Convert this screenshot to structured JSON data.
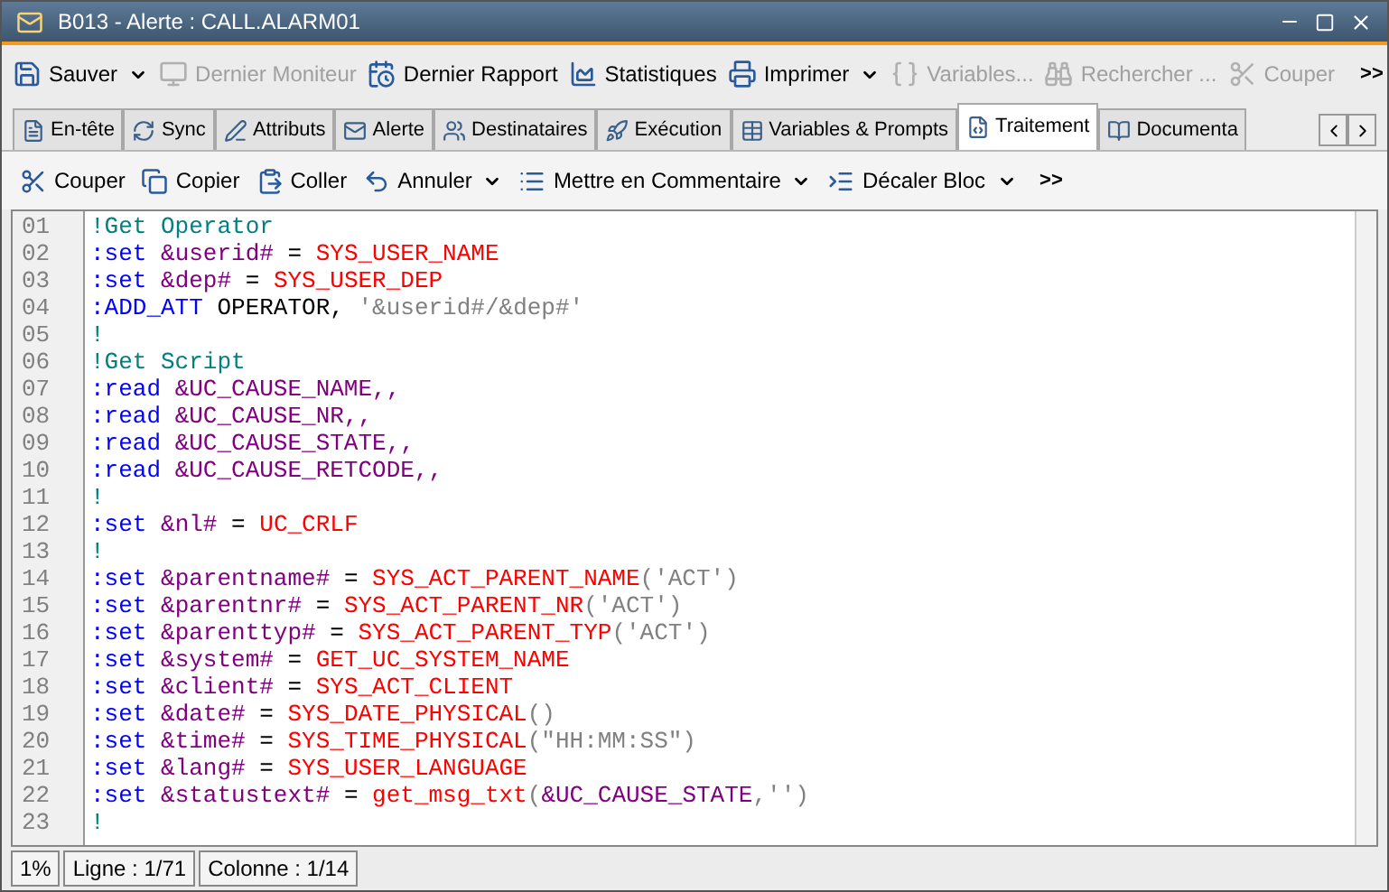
{
  "window": {
    "title": "B013 - Alerte : CALL.ALARM01"
  },
  "toolbar": [
    {
      "label": "Sauver",
      "disabled": false,
      "dropdown": true
    },
    {
      "label": "Dernier Moniteur",
      "disabled": true,
      "dropdown": false
    },
    {
      "label": "Dernier Rapport",
      "disabled": false,
      "dropdown": false
    },
    {
      "label": "Statistiques",
      "disabled": false,
      "dropdown": false
    },
    {
      "label": "Imprimer",
      "disabled": false,
      "dropdown": true
    },
    {
      "label": "Variables...",
      "disabled": true,
      "dropdown": false
    },
    {
      "label": "Rechercher ...",
      "disabled": true,
      "dropdown": false
    },
    {
      "label": "Couper",
      "disabled": true,
      "dropdown": false
    }
  ],
  "toolbar_overflow": ">>",
  "tabs": [
    {
      "label": "En-tête",
      "selected": false
    },
    {
      "label": "Sync",
      "selected": false
    },
    {
      "label": "Attributs",
      "selected": false
    },
    {
      "label": "Alerte",
      "selected": false
    },
    {
      "label": "Destinataires",
      "selected": false
    },
    {
      "label": "Exécution",
      "selected": false
    },
    {
      "label": "Variables & Prompts",
      "selected": false
    },
    {
      "label": "Traitement",
      "selected": true
    },
    {
      "label": "Documenta",
      "selected": false
    }
  ],
  "edit_toolbar": [
    {
      "label": "Couper",
      "dropdown": false
    },
    {
      "label": "Copier",
      "dropdown": false
    },
    {
      "label": "Coller",
      "dropdown": false
    },
    {
      "label": "Annuler",
      "dropdown": true
    },
    {
      "label": "Mettre en Commentaire",
      "dropdown": true
    },
    {
      "label": "Décaler Bloc",
      "dropdown": true
    }
  ],
  "edit_toolbar_overflow": ">>",
  "editor": {
    "lines": [
      {
        "number": "01",
        "tokens": [
          {
            "kind": "comment",
            "text": "!Get Operator"
          }
        ]
      },
      {
        "number": "02",
        "tokens": [
          {
            "kind": "keyword",
            "text": ":set "
          },
          {
            "kind": "variable",
            "text": "&userid#"
          },
          {
            "kind": "plain",
            "text": " = "
          },
          {
            "kind": "function",
            "text": "SYS_USER_NAME"
          }
        ]
      },
      {
        "number": "03",
        "tokens": [
          {
            "kind": "keyword",
            "text": ":set "
          },
          {
            "kind": "variable",
            "text": "&dep#"
          },
          {
            "kind": "plain",
            "text": " = "
          },
          {
            "kind": "function",
            "text": "SYS_USER_DEP"
          }
        ]
      },
      {
        "number": "04",
        "tokens": [
          {
            "kind": "keyword",
            "text": ":ADD_ATT"
          },
          {
            "kind": "plain",
            "text": " OPERATOR, "
          },
          {
            "kind": "string",
            "text": "'&userid#/&dep#'"
          }
        ]
      },
      {
        "number": "05",
        "tokens": [
          {
            "kind": "comment",
            "text": "!"
          }
        ]
      },
      {
        "number": "06",
        "tokens": [
          {
            "kind": "comment",
            "text": "!Get Script"
          }
        ]
      },
      {
        "number": "07",
        "tokens": [
          {
            "kind": "keyword",
            "text": ":read "
          },
          {
            "kind": "variable",
            "text": "&UC_CAUSE_NAME,,"
          }
        ]
      },
      {
        "number": "08",
        "tokens": [
          {
            "kind": "keyword",
            "text": ":read "
          },
          {
            "kind": "variable",
            "text": "&UC_CAUSE_NR,,"
          }
        ]
      },
      {
        "number": "09",
        "tokens": [
          {
            "kind": "keyword",
            "text": ":read "
          },
          {
            "kind": "variable",
            "text": "&UC_CAUSE_STATE,,"
          }
        ]
      },
      {
        "number": "10",
        "tokens": [
          {
            "kind": "keyword",
            "text": ":read "
          },
          {
            "kind": "variable",
            "text": "&UC_CAUSE_RETCODE,,"
          }
        ]
      },
      {
        "number": "11",
        "tokens": [
          {
            "kind": "comment",
            "text": "!"
          }
        ]
      },
      {
        "number": "12",
        "tokens": [
          {
            "kind": "keyword",
            "text": ":set "
          },
          {
            "kind": "variable",
            "text": "&nl#"
          },
          {
            "kind": "plain",
            "text": " = "
          },
          {
            "kind": "function",
            "text": "UC_CRLF"
          }
        ]
      },
      {
        "number": "13",
        "tokens": [
          {
            "kind": "comment",
            "text": "!"
          }
        ]
      },
      {
        "number": "14",
        "tokens": [
          {
            "kind": "keyword",
            "text": ":set "
          },
          {
            "kind": "variable",
            "text": "&parentname#"
          },
          {
            "kind": "plain",
            "text": " = "
          },
          {
            "kind": "function",
            "text": "SYS_ACT_PARENT_NAME"
          },
          {
            "kind": "string",
            "text": "('ACT')"
          }
        ]
      },
      {
        "number": "15",
        "tokens": [
          {
            "kind": "keyword",
            "text": ":set "
          },
          {
            "kind": "variable",
            "text": "&parentnr#"
          },
          {
            "kind": "plain",
            "text": " = "
          },
          {
            "kind": "function",
            "text": "SYS_ACT_PARENT_NR"
          },
          {
            "kind": "string",
            "text": "('ACT')"
          }
        ]
      },
      {
        "number": "16",
        "tokens": [
          {
            "kind": "keyword",
            "text": ":set "
          },
          {
            "kind": "variable",
            "text": "&parenttyp#"
          },
          {
            "kind": "plain",
            "text": " = "
          },
          {
            "kind": "function",
            "text": "SYS_ACT_PARENT_TYP"
          },
          {
            "kind": "string",
            "text": "('ACT')"
          }
        ]
      },
      {
        "number": "17",
        "tokens": [
          {
            "kind": "keyword",
            "text": ":set "
          },
          {
            "kind": "variable",
            "text": "&system#"
          },
          {
            "kind": "plain",
            "text": " = "
          },
          {
            "kind": "function",
            "text": "GET_UC_SYSTEM_NAME"
          }
        ]
      },
      {
        "number": "18",
        "tokens": [
          {
            "kind": "keyword",
            "text": ":set "
          },
          {
            "kind": "variable",
            "text": "&client#"
          },
          {
            "kind": "plain",
            "text": " = "
          },
          {
            "kind": "function",
            "text": "SYS_ACT_CLIENT"
          }
        ]
      },
      {
        "number": "19",
        "tokens": [
          {
            "kind": "keyword",
            "text": ":set "
          },
          {
            "kind": "variable",
            "text": "&date#"
          },
          {
            "kind": "plain",
            "text": " = "
          },
          {
            "kind": "function",
            "text": "SYS_DATE_PHYSICAL"
          },
          {
            "kind": "string",
            "text": "()"
          }
        ]
      },
      {
        "number": "20",
        "tokens": [
          {
            "kind": "keyword",
            "text": ":set "
          },
          {
            "kind": "variable",
            "text": "&time#"
          },
          {
            "kind": "plain",
            "text": " = "
          },
          {
            "kind": "function",
            "text": "SYS_TIME_PHYSICAL"
          },
          {
            "kind": "string",
            "text": "(\"HH:MM:SS\")"
          }
        ]
      },
      {
        "number": "21",
        "tokens": [
          {
            "kind": "keyword",
            "text": ":set "
          },
          {
            "kind": "variable",
            "text": "&lang#"
          },
          {
            "kind": "plain",
            "text": " = "
          },
          {
            "kind": "function",
            "text": "SYS_USER_LANGUAGE"
          }
        ]
      },
      {
        "number": "22",
        "tokens": [
          {
            "kind": "keyword",
            "text": ":set "
          },
          {
            "kind": "variable",
            "text": "&statustext#"
          },
          {
            "kind": "plain",
            "text": " = "
          },
          {
            "kind": "function",
            "text": "get_msg_txt"
          },
          {
            "kind": "string",
            "text": "("
          },
          {
            "kind": "variable",
            "text": "&UC_CAUSE_STATE"
          },
          {
            "kind": "string",
            "text": ",'')"
          }
        ]
      },
      {
        "number": "23",
        "tokens": [
          {
            "kind": "comment",
            "text": "!"
          }
        ]
      }
    ]
  },
  "status_bar": [
    "1%",
    "Ligne : 1/71",
    "Colonne : 1/14"
  ]
}
